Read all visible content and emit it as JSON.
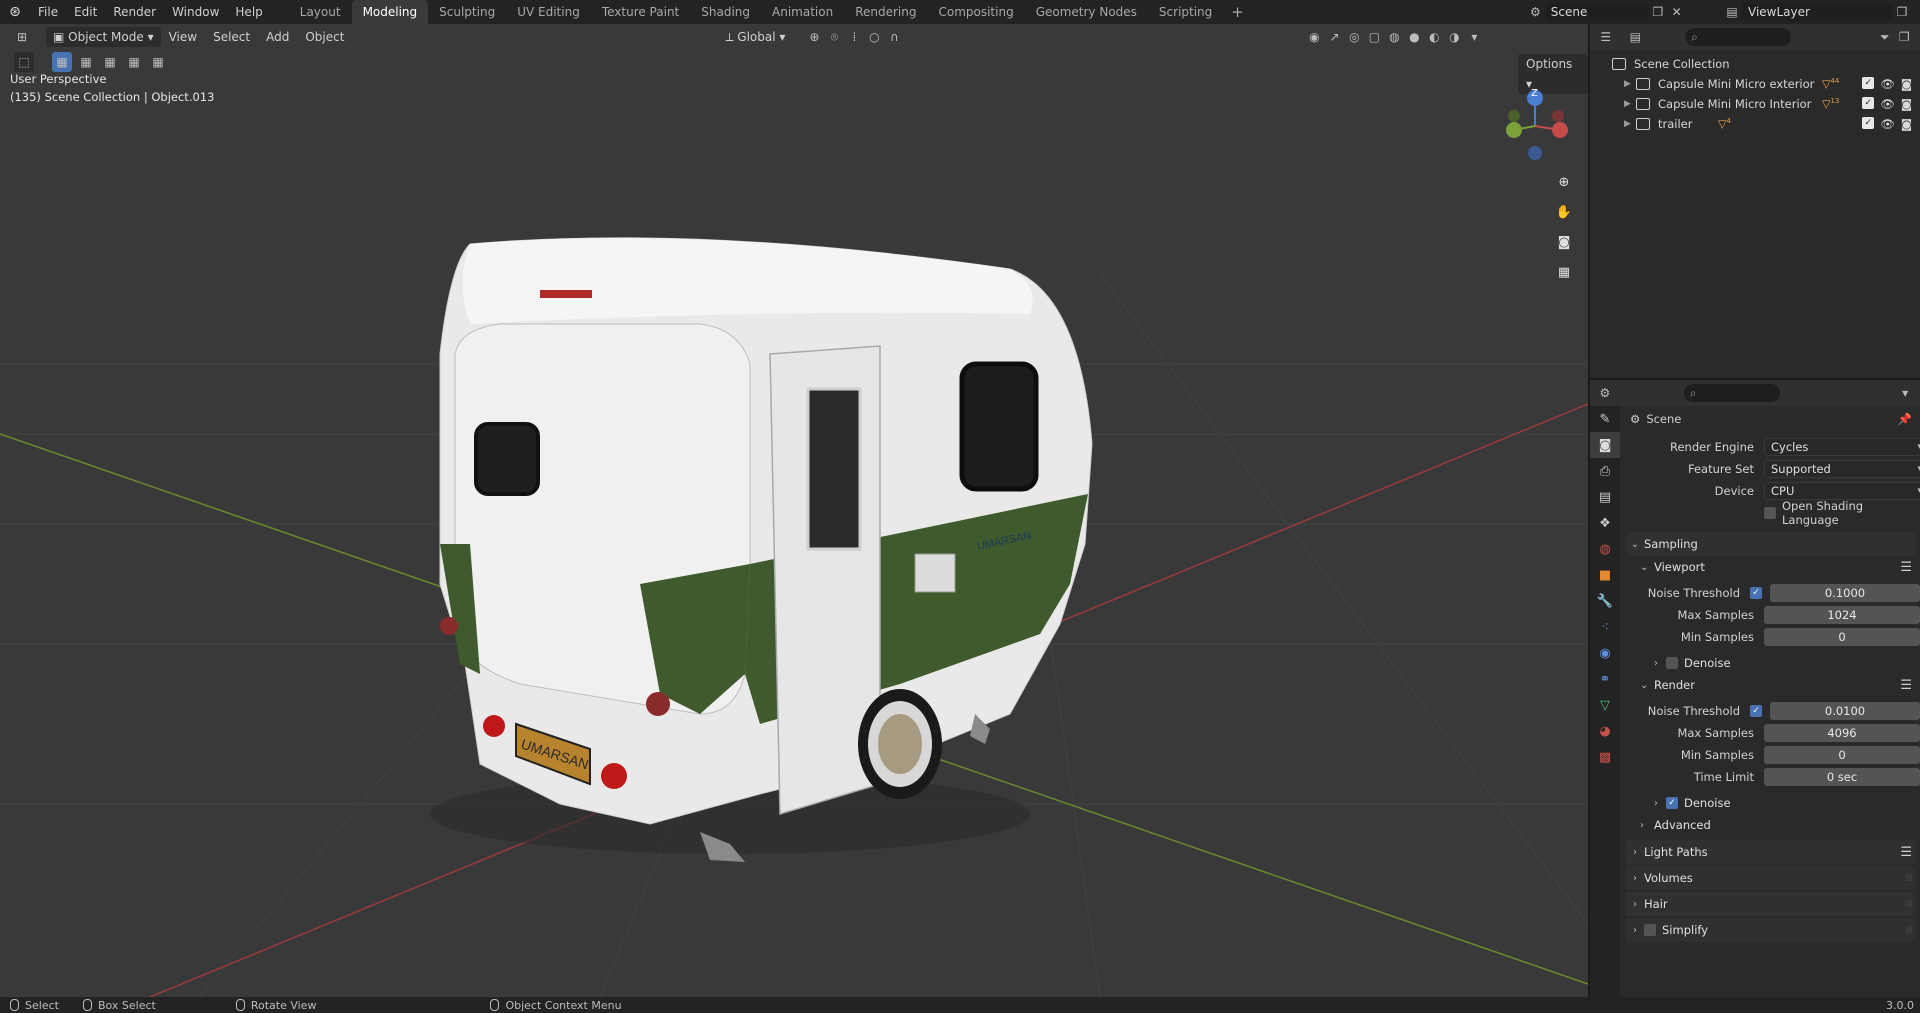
{
  "topbar": {
    "menus": [
      "File",
      "Edit",
      "Render",
      "Window",
      "Help"
    ],
    "workspaces": [
      "Layout",
      "Modeling",
      "Sculpting",
      "UV Editing",
      "Texture Paint",
      "Shading",
      "Animation",
      "Rendering",
      "Compositing",
      "Geometry Nodes",
      "Scripting"
    ],
    "active_workspace": "Modeling",
    "add_tab": "+",
    "scene_name": "Scene",
    "view_layer": "ViewLayer"
  },
  "viewport": {
    "mode": "Object Mode",
    "menus": [
      "View",
      "Select",
      "Add",
      "Object"
    ],
    "transform_orientation": "Global",
    "options_label": "Options",
    "info_line1": "User Perspective",
    "info_line2": "(135) Scene Collection | Object.013",
    "gizmo_z": "Z",
    "plate_text": "UMARSAN",
    "logo_text": "UMARSAN"
  },
  "outliner": {
    "root": "Scene Collection",
    "items": [
      {
        "label": "Capsule Mini Micro  exterior",
        "badge": "44"
      },
      {
        "label": "Capsule Mini Micro  Interior",
        "badge": "13"
      },
      {
        "label": "trailer",
        "badge": "4"
      }
    ]
  },
  "properties": {
    "context": "Scene",
    "render_engine_label": "Render Engine",
    "render_engine": "Cycles",
    "feature_set_label": "Feature Set",
    "feature_set": "Supported",
    "device_label": "Device",
    "device": "CPU",
    "osl_label": "Open Shading Language",
    "sampling": "Sampling",
    "viewport_sub": "Viewport",
    "vp_noise_label": "Noise Threshold",
    "vp_noise": "0.1000",
    "vp_max_label": "Max Samples",
    "vp_max": "1024",
    "vp_min_label": "Min Samples",
    "vp_min": "0",
    "denoise_label": "Denoise",
    "render_sub": "Render",
    "r_noise_label": "Noise Threshold",
    "r_noise": "0.0100",
    "r_max_label": "Max Samples",
    "r_max": "4096",
    "r_min_label": "Min Samples",
    "r_min": "0",
    "time_limit_label": "Time Limit",
    "time_limit": "0 sec",
    "denoise2_label": "Denoise",
    "advanced": "Advanced",
    "light_paths": "Light Paths",
    "volumes": "Volumes",
    "hair": "Hair",
    "simplify": "Simplify"
  },
  "statusbar": {
    "select": "Select",
    "box_select": "Box Select",
    "rotate_view": "Rotate View",
    "context_menu": "Object Context Menu",
    "version": "3.0.0"
  },
  "colors": {
    "accent_blue": "#4772b3",
    "trailer_green": "#3f5a2c",
    "viewport_bg": "#393939"
  }
}
